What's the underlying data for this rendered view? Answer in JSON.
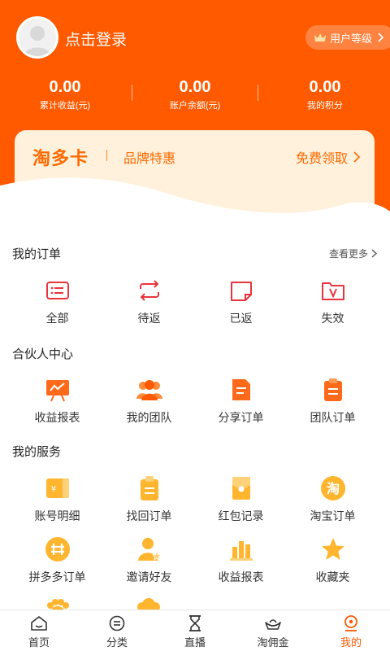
{
  "header": {
    "login_text": "点击登录",
    "level_button": "用户等级",
    "stats": [
      {
        "value": "0.00",
        "label": "累计收益(元)"
      },
      {
        "value": "0.00",
        "label": "账户余额(元)"
      },
      {
        "value": "0.00",
        "label": "我的积分"
      }
    ]
  },
  "card": {
    "title": "淘多卡",
    "subtitle": "品牌特惠",
    "link": "免费领取"
  },
  "orders": {
    "title": "我的订单",
    "more": "查看更多",
    "items": [
      {
        "label": "全部",
        "icon": "list-icon"
      },
      {
        "label": "待返",
        "icon": "refresh-icon"
      },
      {
        "label": "已返",
        "icon": "returned-icon"
      },
      {
        "label": "失效",
        "icon": "expired-icon"
      }
    ]
  },
  "partner": {
    "title": "合伙人中心",
    "items": [
      {
        "label": "收益报表",
        "icon": "chart-board-icon"
      },
      {
        "label": "我的团队",
        "icon": "team-icon"
      },
      {
        "label": "分享订单",
        "icon": "share-order-icon"
      },
      {
        "label": "团队订单",
        "icon": "team-order-icon"
      }
    ]
  },
  "services": {
    "title": "我的服务",
    "rows": [
      [
        {
          "label": "账号明细",
          "icon": "account-detail-icon"
        },
        {
          "label": "找回订单",
          "icon": "retrieve-order-icon"
        },
        {
          "label": "红包记录",
          "icon": "red-packet-icon"
        },
        {
          "label": "淘宝订单",
          "icon": "taobao-icon"
        }
      ],
      [
        {
          "label": "拼多多订单",
          "icon": "pinduoduo-icon"
        },
        {
          "label": "邀请好友",
          "icon": "invite-icon"
        },
        {
          "label": "收益报表",
          "icon": "bar-chart-icon"
        },
        {
          "label": "收藏夹",
          "icon": "star-icon"
        }
      ]
    ]
  },
  "tabbar": {
    "items": [
      {
        "label": "首页",
        "icon": "home-icon"
      },
      {
        "label": "分类",
        "icon": "category-icon"
      },
      {
        "label": "直播",
        "icon": "hourglass-icon"
      },
      {
        "label": "淘佣金",
        "icon": "ingot-icon"
      },
      {
        "label": "我的",
        "icon": "profile-icon"
      }
    ],
    "active": "我的"
  },
  "colors": {
    "brand": "#ff5a00",
    "card_bg": "#fff1dc",
    "order_icon": "#e8343d",
    "service_icon": "#ffb52e"
  }
}
